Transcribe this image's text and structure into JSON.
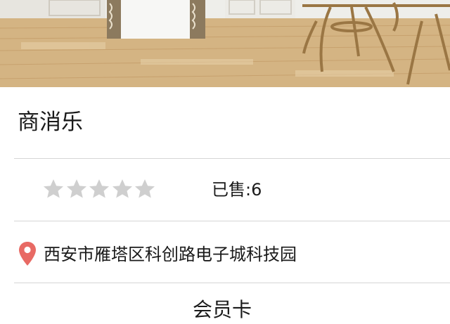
{
  "store": {
    "name": "商消乐",
    "rating": 0,
    "rating_max": 5,
    "sold_label": "已售:6",
    "address": "西安市雁塔区科创路电子城科技园",
    "next_section_label": "会员卡"
  },
  "colors": {
    "star_empty": "#cfcfcf",
    "pin": "#e86a64",
    "divider": "#d6d6d6"
  },
  "icons": {
    "rating": "star-icon",
    "address": "location-pin-icon"
  }
}
